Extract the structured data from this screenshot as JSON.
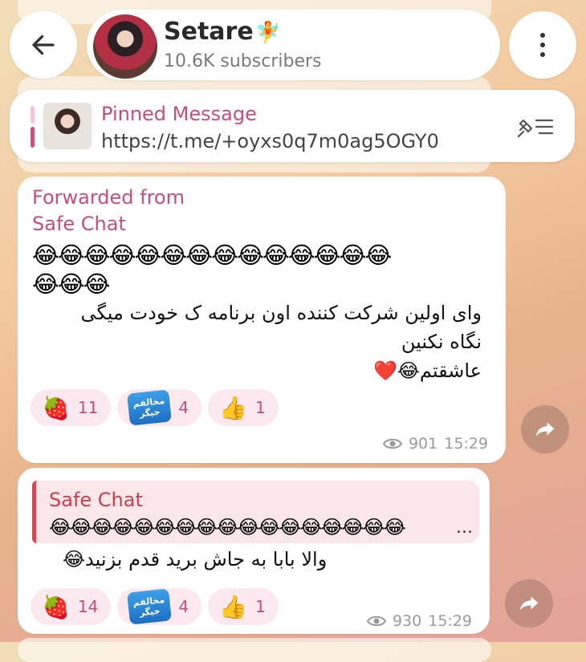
{
  "header": {
    "back_icon": "arrow-left-icon",
    "channel_name": "Setare",
    "channel_emoji": "🧚",
    "subscribers": "10.6K subscribers",
    "menu_icon": "more-vertical-icon"
  },
  "pinned": {
    "title": "Pinned Message",
    "link": "https://t.me/+oyxs0q7m0ag5OGY0",
    "action_icon": "unpin-list-icon"
  },
  "messages": [
    {
      "forwarded_label": "Forwarded from",
      "forwarded_source": "Safe Chat",
      "emoji_line1": "😂😂😂😂😂😂😂😂😂😂😂😂😂😂",
      "emoji_line2": "😂😂😂",
      "text_line1": "وای اولین شرکت کننده اون برنامه ک خودت میگی",
      "text_line2": "نگاه نکنین",
      "text_line3": "عاشقتم😂❤️",
      "reactions": [
        {
          "emoji": "🍓",
          "count": "11"
        },
        {
          "emoji": "مخالفم جیگر",
          "count": "4"
        },
        {
          "emoji": "👍",
          "count": "1"
        }
      ],
      "views": "901",
      "time": "15:29"
    },
    {
      "reply_to": "Safe Chat",
      "reply_preview": "😂😂😂😂😂😂😂😂😂😂😂😂😂😂😂😂😂",
      "reply_ellipsis": "...",
      "text": "والا بابا به جاش برید قدم بزنید😂",
      "reactions": [
        {
          "emoji": "🍓",
          "count": "14"
        },
        {
          "emoji": "مخالفم جیگر",
          "count": "4"
        },
        {
          "emoji": "👍",
          "count": "1"
        }
      ],
      "views": "930",
      "time": "15:29"
    }
  ],
  "colors": {
    "accent_pink": "#c24f80",
    "reply_red": "#c9404d",
    "reaction_bg": "#fbe9ef"
  }
}
